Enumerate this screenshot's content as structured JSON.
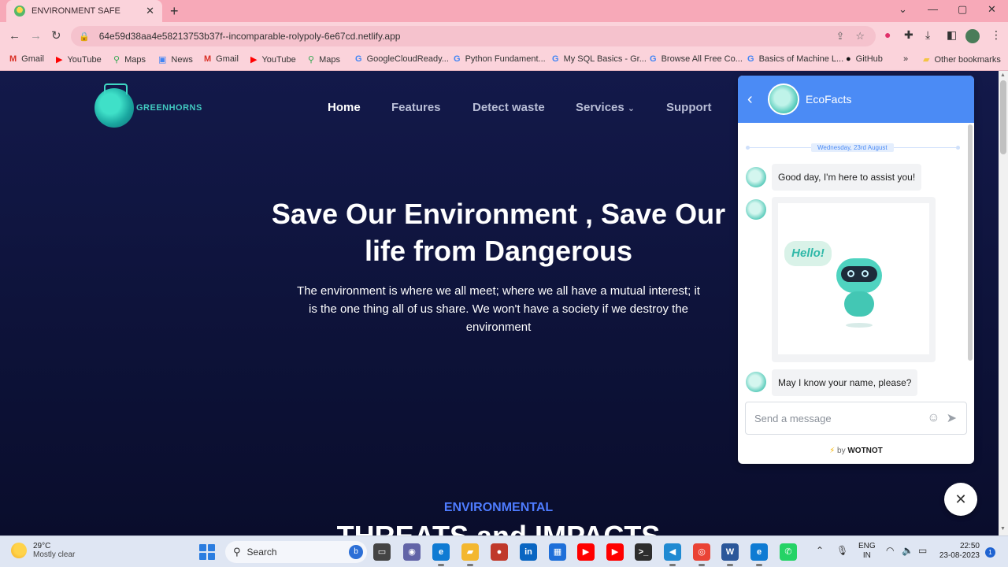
{
  "browser": {
    "tab_title": "ENVIRONMENT SAFE",
    "url": "64e59d38aa4e58213753b37f--incomparable-rolypoly-6e67cd.netlify.app",
    "bookmarks": [
      "Gmail",
      "YouTube",
      "Maps",
      "News",
      "Gmail",
      "YouTube",
      "Maps",
      "GoogleCloudReady...",
      "Python Fundament...",
      "My SQL Basics - Gr...",
      "Browse All Free Co...",
      "Basics of Machine L...",
      "GitHub"
    ],
    "other_bookmarks": "Other bookmarks",
    "more_bookmarks": "»"
  },
  "site": {
    "brand": "GREENHORNS",
    "nav": [
      "Home",
      "Features",
      "Detect waste",
      "Services",
      "Support"
    ],
    "active_nav": "Home",
    "hero_title": "Save Our Environment , Save Our life from Dangerous",
    "hero_text": "The environment is where we all meet; where we all have a mutual interest; it is the one thing all of us share. We won't have a society if we destroy the environment",
    "section_kicker": "ENVIRONMENTAL",
    "section_title": "THREATS and IMPACTS"
  },
  "chat": {
    "bot_name": "EcoFacts",
    "date": "Wednesday, 23rd August",
    "msg1": "Good day, I'm here to assist you!",
    "image_text": "Hello!",
    "msg2": "May I know your name, please?",
    "input_placeholder": "Send a message",
    "powered_prefix": "by",
    "powered_brand": "WOTNOT"
  },
  "taskbar": {
    "temperature": "29°C",
    "condition": "Mostly clear",
    "search_label": "Search",
    "lang_line1": "ENG",
    "lang_line2": "IN",
    "time": "22:50",
    "date": "23-08-2023",
    "notification_count": "1"
  },
  "colors": {
    "page_bg": "#13194a",
    "accent_blue": "#4b8bf5",
    "kicker": "#4e7cff",
    "chrome_pink": "#fbd3db"
  }
}
